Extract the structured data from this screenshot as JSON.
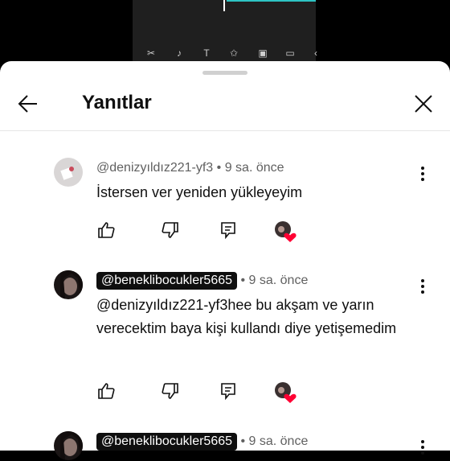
{
  "header": {
    "title": "Yanıtlar"
  },
  "comments": [
    {
      "handle": "@denizyıldız221-yf3",
      "time": "• 9 sa. önce",
      "text": "İstersen ver yeniden yükleyeyim",
      "highlighted": false
    },
    {
      "handle": "@beneklibocukler5665",
      "time": "• 9 sa. önce",
      "text": "@denizyıldız221-yf3hee bu akşam ve yarın verecektim baya kişi kullandı diye yetişemedim",
      "highlighted": true
    },
    {
      "handle": "@beneklibocukler5665",
      "time": "• 9 sa. önce",
      "text": "",
      "highlighted": true
    }
  ],
  "icons": {
    "back": "arrow-left-icon",
    "close": "close-icon",
    "like": "thumbs-up-icon",
    "dislike": "thumbs-down-icon",
    "reply": "reply-icon",
    "more": "more-vertical-icon",
    "creator_heart": "creator-heart-icon"
  },
  "colors": {
    "heart": "#ff0033",
    "pill": "#0f0f0f",
    "meta": "#606060"
  }
}
